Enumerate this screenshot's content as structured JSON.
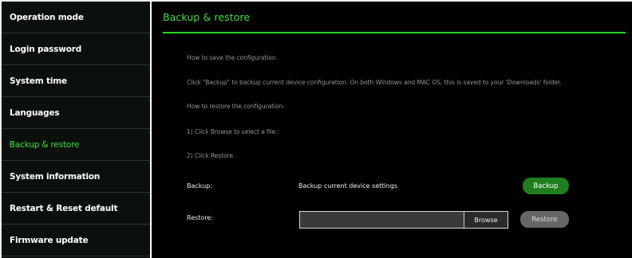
{
  "sidebar": {
    "items": [
      {
        "label": "Operation mode"
      },
      {
        "label": "Login password"
      },
      {
        "label": "System time"
      },
      {
        "label": "Languages"
      },
      {
        "label": "Backup & restore"
      },
      {
        "label": "System information"
      },
      {
        "label": "Restart & Reset default"
      },
      {
        "label": "Firmware update"
      }
    ],
    "active_index": 4
  },
  "main": {
    "title": "Backup & restore",
    "info": [
      "How to save the configuration.",
      "Click \"Backup\" to backup current device configuration. On both Windows and MAC OS, this is saved to your 'Downloads' folder.",
      "How to restore the configuration:",
      "1) Click Browse to select a file.",
      "2) Click Restore."
    ],
    "backup": {
      "label": "Backup:",
      "description": "Backup current device settings",
      "button_label": "Backup"
    },
    "restore": {
      "label": "Restore:",
      "browse_label": "Browse",
      "file_value": "",
      "button_label": "Restore"
    }
  },
  "colors": {
    "accent": "#33e033",
    "sidebar_bg": "#0b100c",
    "main_bg": "#000000",
    "backup_button": "#1f7f1f",
    "restore_button": "#666666"
  }
}
